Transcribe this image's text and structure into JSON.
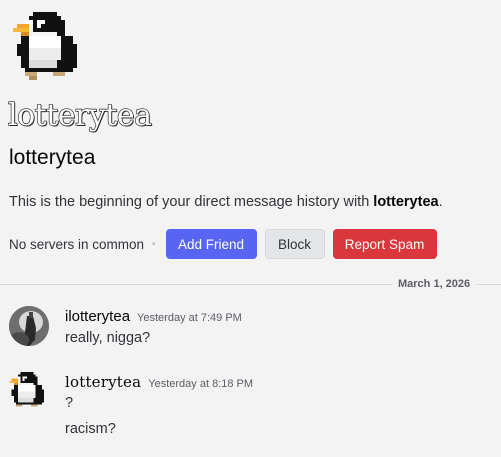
{
  "profile": {
    "display_name": "lotterytea",
    "username": "lotterytea",
    "avatar_icon": "penguin-pixel-icon"
  },
  "intro": {
    "prefix": "This is the beginning of your direct message history with ",
    "name": "lotterytea",
    "suffix": "."
  },
  "actions": {
    "no_servers": "No servers in common",
    "add_friend": "Add Friend",
    "block": "Block",
    "report_spam": "Report Spam"
  },
  "divider": {
    "date": "March 1, 2026"
  },
  "messages": [
    {
      "author": "ilotterytea",
      "timestamp": "Yesterday at 7:49 PM",
      "lines": [
        "really, nigga?"
      ]
    },
    {
      "author": "lotterytea",
      "timestamp": "Yesterday at 8:18 PM",
      "lines": [
        "?",
        "racism?"
      ]
    }
  ],
  "colors": {
    "background": "#f3f3f4",
    "add_friend": "#5865f2",
    "report_spam": "#da373c",
    "block": "#e3e5e8"
  }
}
